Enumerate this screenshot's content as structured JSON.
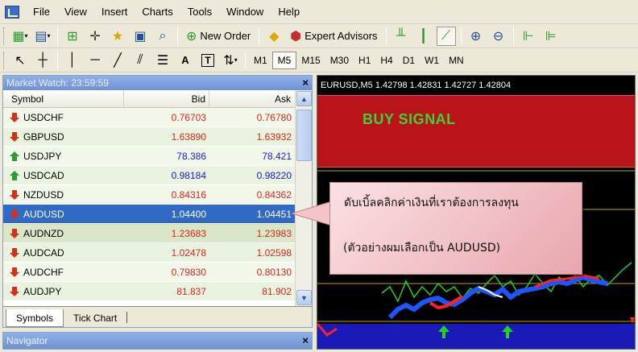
{
  "menu": [
    "File",
    "View",
    "Insert",
    "Charts",
    "Tools",
    "Window",
    "Help"
  ],
  "toolbar": {
    "new_order_label": "New Order",
    "expert_advisors_label": "Expert Advisors"
  },
  "timeframes": [
    "M1",
    "M5",
    "M15",
    "M30",
    "H1",
    "H4",
    "D1",
    "W1",
    "MN"
  ],
  "active_timeframe": "M5",
  "drawing_tools": {
    "text_label": "A",
    "text_box_label": "T"
  },
  "market_watch": {
    "title": "Market Watch: 23:59:59",
    "columns": {
      "symbol": "Symbol",
      "bid": "Bid",
      "ask": "Ask"
    },
    "rows": [
      {
        "symbol": "USDCHF",
        "bid": "0.76703",
        "ask": "0.76780",
        "direction": "down",
        "color": "#e0241b"
      },
      {
        "symbol": "GBPUSD",
        "bid": "1.63890",
        "ask": "1.63932",
        "direction": "down",
        "color": "#e0241b"
      },
      {
        "symbol": "USDJPY",
        "bid": "78.386",
        "ask": "78.421",
        "direction": "up",
        "color": "#1a1ad0"
      },
      {
        "symbol": "USDCAD",
        "bid": "0.98184",
        "ask": "0.98220",
        "direction": "up",
        "color": "#1a1ad0"
      },
      {
        "symbol": "NZDUSD",
        "bid": "0.84316",
        "ask": "0.84362",
        "direction": "down",
        "color": "#e0241b"
      },
      {
        "symbol": "AUDUSD",
        "bid": "1.04400",
        "ask": "1.04451",
        "direction": "down",
        "color": "#ffffff"
      },
      {
        "symbol": "AUDNZD",
        "bid": "1.23683",
        "ask": "1.23983",
        "direction": "down",
        "color": "#e0241b"
      },
      {
        "symbol": "AUDCAD",
        "bid": "1.02478",
        "ask": "1.02598",
        "direction": "down",
        "color": "#e0241b"
      },
      {
        "symbol": "AUDCHF",
        "bid": "0.79830",
        "ask": "0.80130",
        "direction": "down",
        "color": "#e0241b"
      },
      {
        "symbol": "AUDJPY",
        "bid": "81.837",
        "ask": "81.902",
        "direction": "down",
        "color": "#e0241b"
      }
    ],
    "tabs": [
      "Symbols",
      "Tick Chart"
    ],
    "active_tab": "Symbols"
  },
  "navigator": {
    "title": "Navigator"
  },
  "chart": {
    "header": "EURUSD,M5  1.42798 1.42831 1.42727 1.42804",
    "signal_text": "BUY SIGNAL",
    "colors": {
      "background": "#000000",
      "signal_zone": "#b8141a",
      "signal_text": "#3ad43a",
      "band": "#1a1ab8"
    }
  },
  "callout": {
    "line1": "ดับเบิ้ลคลิกค่าเงินที่เราต้องการลงทุน",
    "line2": "(ตัวอย่างผมเลือกเป็น AUDUSD)"
  }
}
